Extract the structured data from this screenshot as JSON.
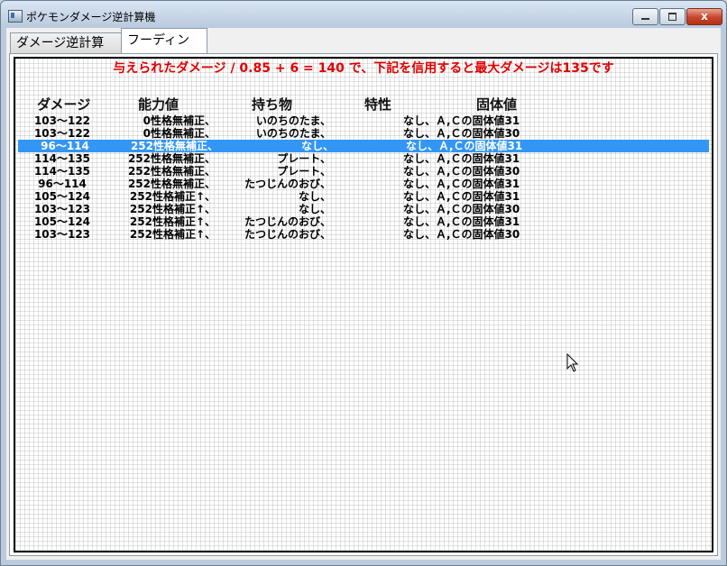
{
  "window": {
    "title": "ポケモンダメージ逆計算機",
    "close_label": "x"
  },
  "tabs": [
    {
      "label": "ダメージ逆計算",
      "active": false
    },
    {
      "label": "フーディン",
      "active": true
    }
  ],
  "headline": "与えられたダメージ / 0.85 + 6 = 140 で、下記を信用すると最大ダメージは135です",
  "columns": {
    "damage": "ダメージ",
    "stat": "能力値",
    "item": "持ち物",
    "ability": "特性",
    "iv": "固体値"
  },
  "rows": [
    {
      "damage": "103～122",
      "stat": "0性格無補正、",
      "item": "いのちのたま、",
      "iv": "なし、Ａ,Ｃの固体値31",
      "selected": false
    },
    {
      "damage": "103～122",
      "stat": "0性格無補正、",
      "item": "いのちのたま、",
      "iv": "なし、Ａ,Ｃの固体値30",
      "selected": false
    },
    {
      "damage": "96～114",
      "stat": "252性格無補正、",
      "item": "なし、",
      "iv": "なし、Ａ,Ｃの固体値31",
      "selected": true
    },
    {
      "damage": "114～135",
      "stat": "252性格無補正、",
      "item": "プレート、",
      "iv": "なし、Ａ,Ｃの固体値31",
      "selected": false
    },
    {
      "damage": "114～135",
      "stat": "252性格無補正、",
      "item": "プレート、",
      "iv": "なし、Ａ,Ｃの固体値30",
      "selected": false
    },
    {
      "damage": "96～114",
      "stat": "252性格無補正、",
      "item": "たつじんのおび、",
      "iv": "なし、Ａ,Ｃの固体値31",
      "selected": false
    },
    {
      "damage": "105～124",
      "stat": "252性格補正↑、",
      "item": "なし、",
      "iv": "なし、Ａ,Ｃの固体値31",
      "selected": false
    },
    {
      "damage": "103～123",
      "stat": "252性格補正↑、",
      "item": "なし、",
      "iv": "なし、Ａ,Ｃの固体値30",
      "selected": false
    },
    {
      "damage": "105～124",
      "stat": "252性格補正↑、",
      "item": "たつじんのおび、",
      "iv": "なし、Ａ,Ｃの固体値31",
      "selected": false
    },
    {
      "damage": "103～123",
      "stat": "252性格補正↑、",
      "item": "たつじんのおび、",
      "iv": "なし、Ａ,Ｃの固体値30",
      "selected": false
    }
  ],
  "colors": {
    "headline": "#e00000",
    "selection": "#3396f5"
  }
}
